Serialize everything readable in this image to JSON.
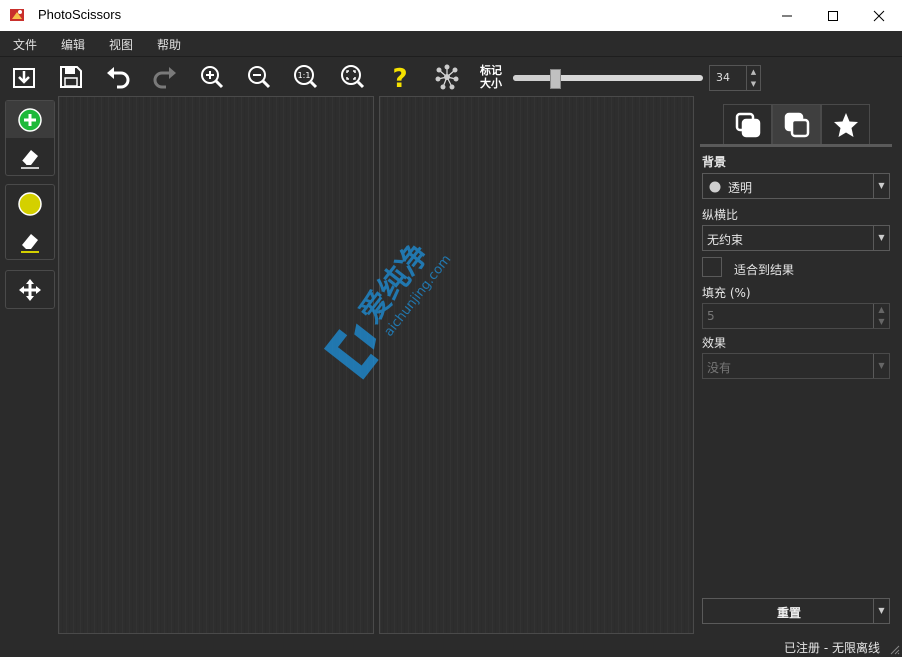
{
  "window": {
    "title": "PhotoScissors",
    "icon": "photoscissors-app-icon",
    "controls": [
      "minimize-icon",
      "maximize-icon",
      "close-icon"
    ]
  },
  "menu": {
    "file": "文件",
    "edit": "编辑",
    "view": "视图",
    "help": "帮助"
  },
  "toolbar": {
    "icons": [
      "open-file-icon",
      "save-icon",
      "undo-icon",
      "redo-icon",
      "zoom-in-icon",
      "zoom-out-icon",
      "actual-size-icon",
      "fit-window-icon",
      "help-icon",
      "network-icon"
    ],
    "marker_size_label_line1": "标记",
    "marker_size_label_line2": "大小",
    "marker_size_value": "34",
    "marker_size_level": 0.12
  },
  "left_tools": {
    "groups": [
      [
        "add-foreground-marker-icon",
        "erase-foreground-icon"
      ],
      [
        "background-marker-icon",
        "erase-background-icon"
      ],
      [
        "move-icon"
      ]
    ]
  },
  "right_panel": {
    "tabs": [
      "background-tab-icon",
      "foreground-tab-icon",
      "effects-tab-icon"
    ],
    "selected_tab": 1,
    "background_label": "背景",
    "background_value": "透明",
    "aspect_label": "纵横比",
    "aspect_value": "无约束",
    "fit_result_label": "适合到结果",
    "padding_label": "填充 (%)",
    "padding_value": "5",
    "effect_label": "效果",
    "effect_value": "没有",
    "reset_label": "重置"
  },
  "status": {
    "text": "已注册 - 无限离线"
  },
  "watermark": {
    "text_cn": "爱纯净",
    "text_en": "aichunjing.com"
  },
  "colors": {
    "accent_green": "#1db93a",
    "marker_yellow": "#d4d000",
    "help_yellow": "#f5e100",
    "watermark_blue": "#1e8fd6"
  }
}
